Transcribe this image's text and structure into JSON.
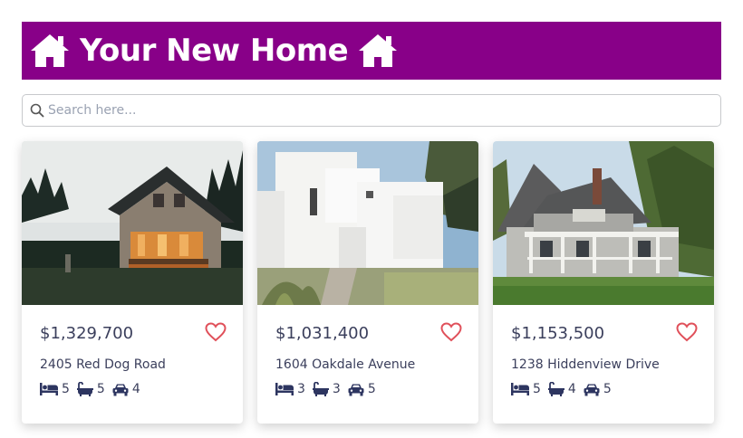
{
  "header": {
    "title": "Your New Home",
    "icon": "home-icon",
    "background": "#880088"
  },
  "search": {
    "placeholder": "Search here...",
    "value": "",
    "icon": "search-icon"
  },
  "listings": [
    {
      "price": "$1,329,700",
      "address": "2405 Red Dog Road",
      "beds": "5",
      "baths": "5",
      "cars": "4",
      "photo": "dark-wooden-cabin-at-dusk"
    },
    {
      "price": "$1,031,400",
      "address": "1604 Oakdale Avenue",
      "beds": "3",
      "baths": "3",
      "cars": "5",
      "photo": "white-modern-house"
    },
    {
      "price": "$1,153,500",
      "address": "1238 Hiddenview Drive",
      "beds": "5",
      "baths": "4",
      "cars": "5",
      "photo": "grey-craftsman-house-with-porch"
    }
  ],
  "icons": {
    "favorite": "heart-icon",
    "beds": "bed-icon",
    "baths": "bath-icon",
    "cars": "car-icon"
  },
  "colors": {
    "accent": "#880088",
    "heart": "#e0505a",
    "text": "#3b3f5c"
  }
}
